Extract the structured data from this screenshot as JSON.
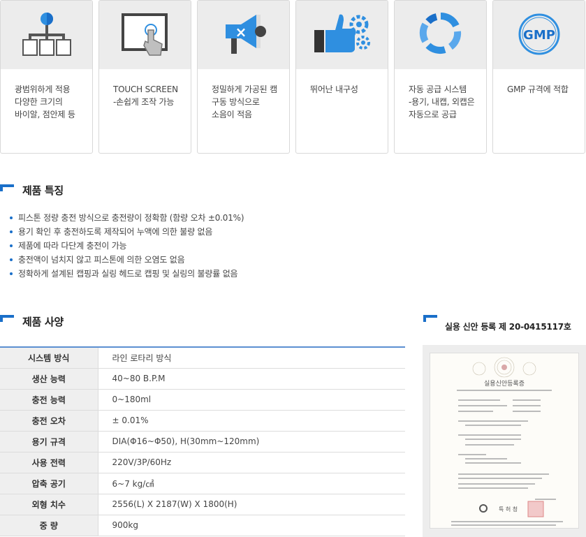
{
  "cards": [
    {
      "icon": "hierarchy-icon",
      "lines": [
        "광범위하게 적용",
        "다양한 크기의",
        "바이알, 점안제 등"
      ]
    },
    {
      "icon": "touch-screen-icon",
      "lines": [
        "TOUCH SCREEN",
        "-손쉽게 조작 가능"
      ]
    },
    {
      "icon": "megaphone-mute-icon",
      "lines": [
        "정밀하게 가공된 캠",
        "구동 방식으로",
        "소음이 적음"
      ]
    },
    {
      "icon": "thumbs-up-gear-icon",
      "lines": [
        "뛰어난 내구성"
      ]
    },
    {
      "icon": "cycle-arrows-icon",
      "lines": [
        "자동 공급 시스템",
        "-용기, 내캡, 외캡은",
        "자동으로 공급"
      ]
    },
    {
      "icon": "gmp-badge-icon",
      "badge_text": "GMP",
      "lines": [
        "GMP 규격에 적합"
      ]
    }
  ],
  "features": {
    "title": "제품 특징",
    "items": [
      "피스톤 정량 충전 방식으로 충전량이 정확함 (함량 오차 ±0.01%)",
      "용기 확인 후 충전하도록 제작되어 누액에 의한 불량 없음",
      "제품에 따라 다단계 충전이 가능",
      "충전액이 넘치지 않고 피스톤에 의한 오염도 없음",
      "정확하게 설계된 캡핑과 실링 헤드로 캡핑 및 실링의 불량률 없음"
    ]
  },
  "spec": {
    "title": "제품 사양",
    "rows": [
      {
        "k": "시스템 방식",
        "v": "라인 로타리 방식"
      },
      {
        "k": "생산 능력",
        "v": "40~80 B.P.M"
      },
      {
        "k": "충전 능력",
        "v": "0~180ml"
      },
      {
        "k": "충전 오차",
        "v": "± 0.01%"
      },
      {
        "k": "용기 규격",
        "v": "DIA(Φ16~Φ50), H(30mm~120mm)"
      },
      {
        "k": "사용 전력",
        "v": "220V/3P/60Hz"
      },
      {
        "k": "압축 공기",
        "v": "6~7 kg/㎠"
      },
      {
        "k": "외형 치수",
        "v": "2556(L) X 2187(W) X 1800(H)"
      },
      {
        "k": "중 량",
        "v": "900kg"
      }
    ]
  },
  "certificate": {
    "title": "실용 신안 등록 제 20-0415117호",
    "doc_title": "실용신안등록증"
  },
  "colors": {
    "accent": "#1a6fc9",
    "icon_blue": "#2f8fe0",
    "icon_gray": "#555555"
  }
}
